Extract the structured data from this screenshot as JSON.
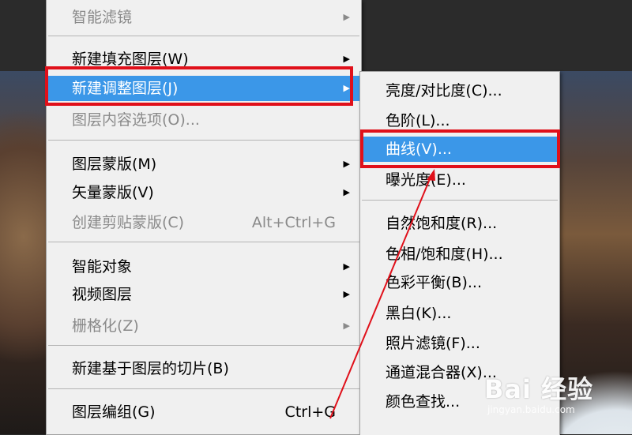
{
  "main_menu": {
    "items": [
      {
        "label": "智能滤镜",
        "disabled": true,
        "submenu": true
      },
      {
        "label": "新建填充图层(W)",
        "submenu": true
      },
      {
        "label": "新建调整图层(J)",
        "submenu": true,
        "highlighted": true
      },
      {
        "label": "图层内容选项(O)...",
        "disabled": true
      },
      {
        "label": "图层蒙版(M)",
        "submenu": true
      },
      {
        "label": "矢量蒙版(V)",
        "submenu": true
      },
      {
        "label": "创建剪贴蒙版(C)",
        "disabled": true,
        "shortcut": "Alt+Ctrl+G"
      },
      {
        "label": "智能对象",
        "submenu": true
      },
      {
        "label": "视频图层",
        "submenu": true
      },
      {
        "label": "栅格化(Z)",
        "disabled": true,
        "submenu": true
      },
      {
        "label": "新建基于图层的切片(B)"
      },
      {
        "label": "图层编组(G)",
        "shortcut": "Ctrl+G"
      }
    ]
  },
  "adjustment_submenu": {
    "items": [
      {
        "label": "亮度/对比度(C)..."
      },
      {
        "label": "色阶(L)..."
      },
      {
        "label": "曲线(V)...",
        "highlighted": true
      },
      {
        "label": "曝光度(E)..."
      },
      {
        "label": "自然饱和度(R)..."
      },
      {
        "label": "色相/饱和度(H)..."
      },
      {
        "label": "色彩平衡(B)..."
      },
      {
        "label": "黑白(K)..."
      },
      {
        "label": "照片滤镜(F)..."
      },
      {
        "label": "通道混合器(X)..."
      },
      {
        "label": "颜色查找..."
      }
    ]
  },
  "watermark": {
    "brand": "Bai 经验",
    "url": "jingyan.baidu.com"
  },
  "colors": {
    "highlight": "#3b97e8",
    "annotation_red": "#e0101a",
    "menu_bg": "#f0f0f0"
  }
}
